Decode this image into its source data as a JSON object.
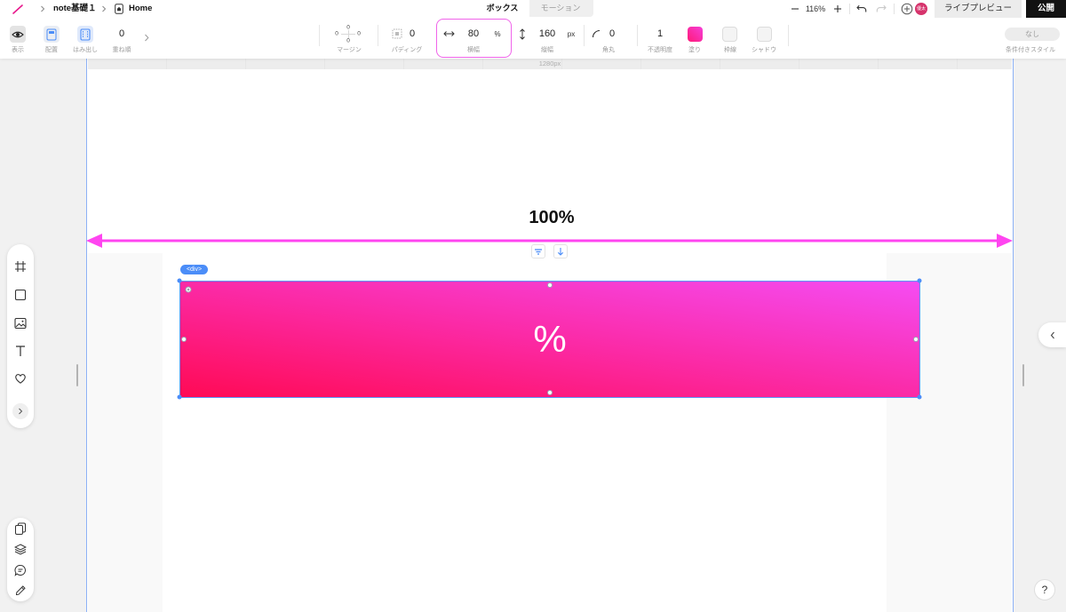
{
  "header": {
    "breadcrumb": {
      "project": "note基礎１",
      "page": "Home"
    },
    "tabs": [
      {
        "label": "ボックス",
        "active": true
      },
      {
        "label": "モーション",
        "active": false
      }
    ],
    "zoom_level": "116%",
    "avatar_text": "優太",
    "live_preview_label": "ライブプレビュー",
    "publish_label": "公開"
  },
  "toolbar": {
    "display": {
      "label": "表示"
    },
    "placement": {
      "label": "配置"
    },
    "overflow": {
      "label": "はみ出し"
    },
    "z_order": {
      "value": "0",
      "label": "重ね順"
    },
    "margin": {
      "top": "0",
      "left": "0",
      "right": "0",
      "bottom": "0",
      "label": "マージン"
    },
    "padding": {
      "value": "0",
      "label": "パディング"
    },
    "width": {
      "value": "80",
      "unit": "%",
      "label": "横幅"
    },
    "height": {
      "value": "160",
      "unit": "px",
      "label": "縦幅"
    },
    "radius": {
      "value": "0",
      "label": "角丸"
    },
    "opacity": {
      "value": "1",
      "label": "不透明度"
    },
    "fill": {
      "label": "塗り",
      "color": "#ff2e9f"
    },
    "border": {
      "label": "枠線"
    },
    "shadow": {
      "label": "シャドウ"
    },
    "conditional_style": {
      "value": "なし",
      "label": "条件付きスタイル"
    }
  },
  "canvas": {
    "ruler_label": "1280px",
    "annotation_label": "100%",
    "element_tag": "<div>",
    "box_text": "%",
    "box_gradient": [
      "#ff0a55",
      "#f54cf3"
    ]
  },
  "help_label": "?",
  "colors": {
    "accent_pink": "#ff2e9f",
    "annotation_magenta": "#ff45f0",
    "selection_blue": "#4b8df8",
    "publish_bg": "#121212",
    "avatar_bg": "#d6336c"
  },
  "icons": {
    "header": [
      "pen-logo-icon",
      "chevron-right-icon",
      "home-page-icon",
      "minus-icon",
      "plus-icon",
      "undo-icon",
      "redo-icon",
      "plus-circle-icon"
    ],
    "toolbar": [
      "eye-icon",
      "placement-icon",
      "overflow-icon",
      "chevron-right-icon",
      "padding-icon",
      "width-arrows-icon",
      "height-arrows-icon",
      "corner-radius-icon"
    ],
    "tools": [
      "frame-icon",
      "rectangle-icon",
      "image-icon",
      "text-icon",
      "heart-icon",
      "expand-chevron-icon"
    ],
    "bottom_tools": [
      "pages-icon",
      "layers-icon",
      "comment-icon",
      "pen-icon"
    ],
    "canvas": [
      "align-icon",
      "arrow-down-icon"
    ],
    "panel": [
      "collapse-chevron-icon",
      "help-icon"
    ]
  }
}
